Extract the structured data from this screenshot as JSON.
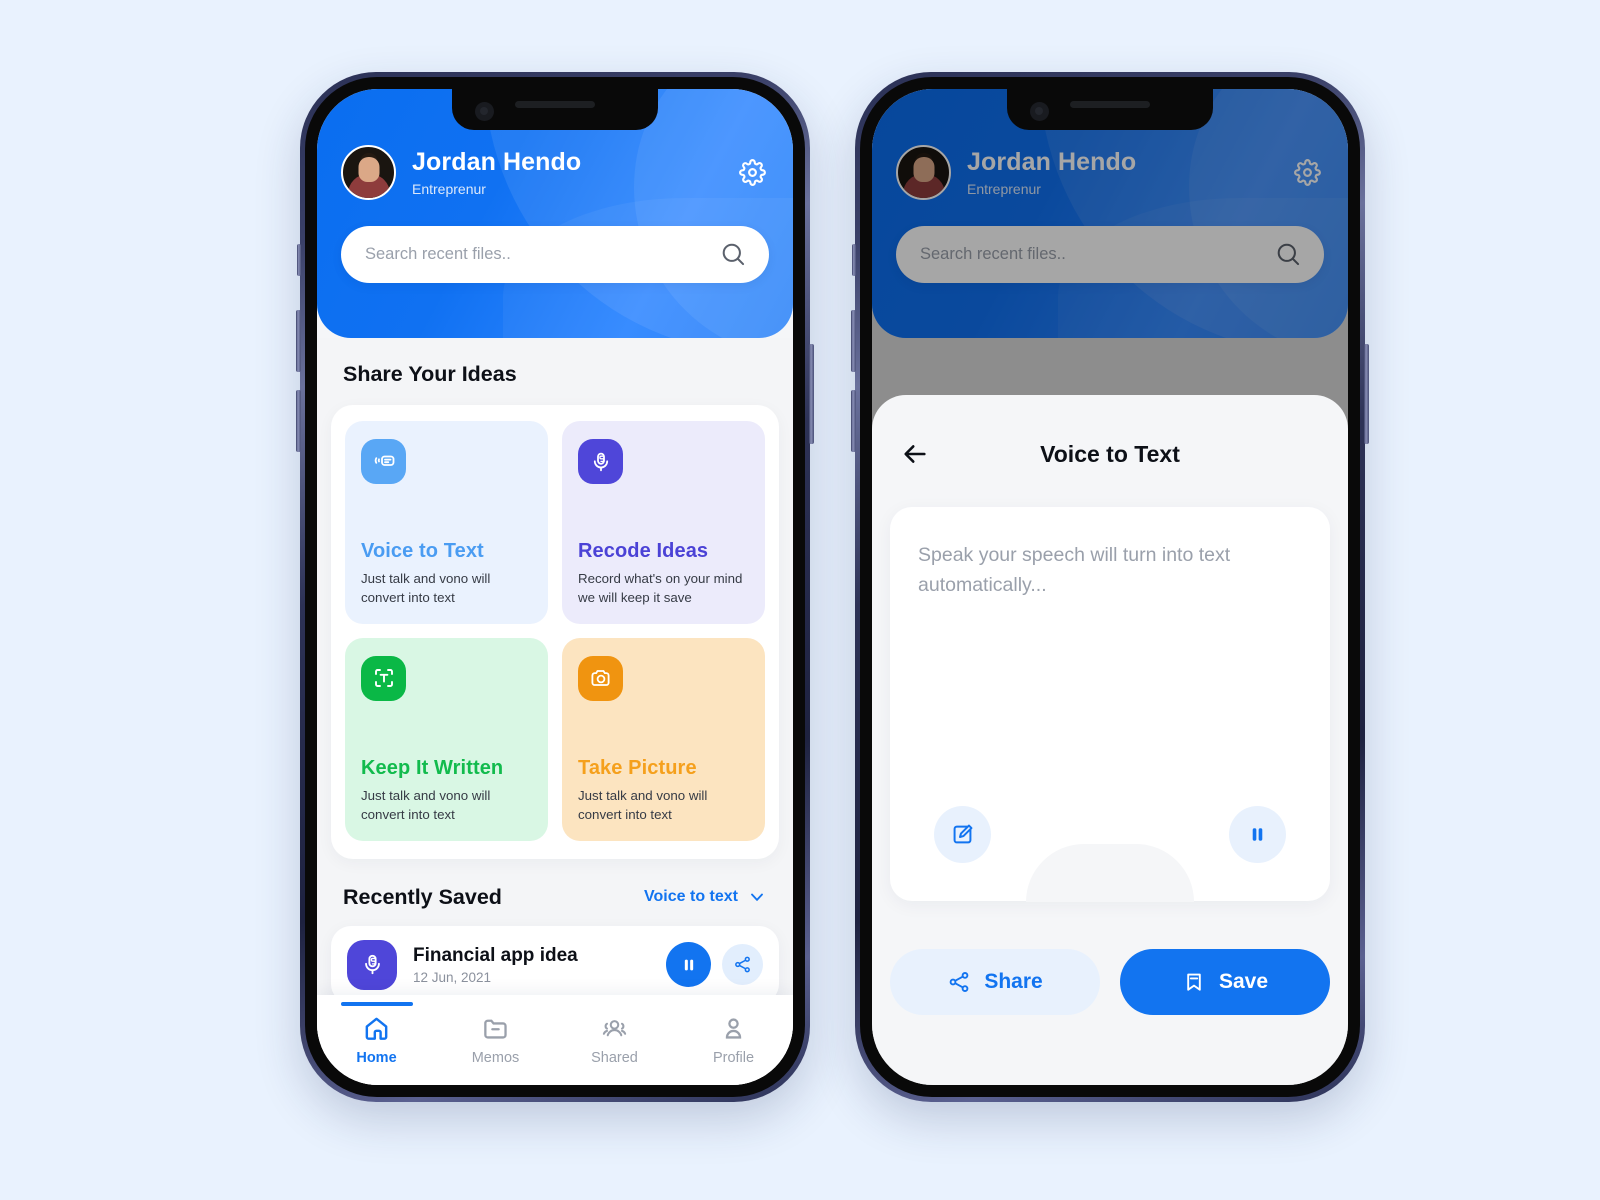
{
  "theme": {
    "page_bg": "#e9f2fe",
    "primary": "#1274f0",
    "purple": "#4f46d9",
    "green": "#0ab846",
    "orange": "#f09410",
    "light_blue": "#59a7f5"
  },
  "header": {
    "user_name": "Jordan Hendo",
    "user_role": "Entreprenur",
    "settings_icon": "gear-icon",
    "avatar_icon": "avatar"
  },
  "search": {
    "placeholder": "Search recent files..",
    "value": "",
    "icon": "search-icon"
  },
  "share_section": {
    "title": "Share Your Ideas",
    "cards": [
      {
        "name": "Voice to Text",
        "desc": "Just talk and vono will convert into text",
        "icon": "voice-to-text-icon",
        "accent": "#4a9cf2",
        "icon_bg": "#59a7f5",
        "card_bg": "#eaf2fe"
      },
      {
        "name": "Recode Ideas",
        "desc": "Record what's on your mind we will keep it  save",
        "icon": "microphone-icon",
        "accent": "#4b42d6",
        "icon_bg": "#4f46d9",
        "card_bg": "#ecebfb"
      },
      {
        "name": "Keep It Written",
        "desc": "Just talk and vono will convert into text",
        "icon": "text-scan-icon",
        "accent": "#12bb4d",
        "icon_bg": "#0ab846",
        "card_bg": "#d9f7e4"
      },
      {
        "name": "Take Picture",
        "desc": "Just talk and vono will convert into text",
        "icon": "camera-icon",
        "accent": "#f5a01c",
        "icon_bg": "#f09410",
        "card_bg": "#fce4c0"
      }
    ]
  },
  "recent_section": {
    "title": "Recently Saved",
    "filter_label": "Voice to text",
    "filter_icon": "chevron-down-icon",
    "items": [
      {
        "title": "Financial app idea",
        "date": "12 Jun, 2021",
        "icon": "microphone-icon",
        "play_icon": "pause-icon",
        "share_icon": "share-icon"
      }
    ]
  },
  "tabbar": {
    "items": [
      {
        "label": "Home",
        "icon": "home-icon",
        "active": true
      },
      {
        "label": "Memos",
        "icon": "folder-minus-icon",
        "active": false
      },
      {
        "label": "Shared",
        "icon": "users-icon",
        "active": false
      },
      {
        "label": "Profile",
        "icon": "person-icon",
        "active": false
      }
    ]
  },
  "modal": {
    "title": "Voice to Text",
    "back_icon": "arrow-left-icon",
    "note_placeholder": "Speak your speech will turn into text automatically...",
    "edit_icon": "edit-icon",
    "pause_icon": "pause-icon",
    "mic_icon": "microphone-icon",
    "share_button": "Share",
    "share_button_icon": "share-icon",
    "save_button": "Save",
    "save_button_icon": "bookmark-icon"
  }
}
